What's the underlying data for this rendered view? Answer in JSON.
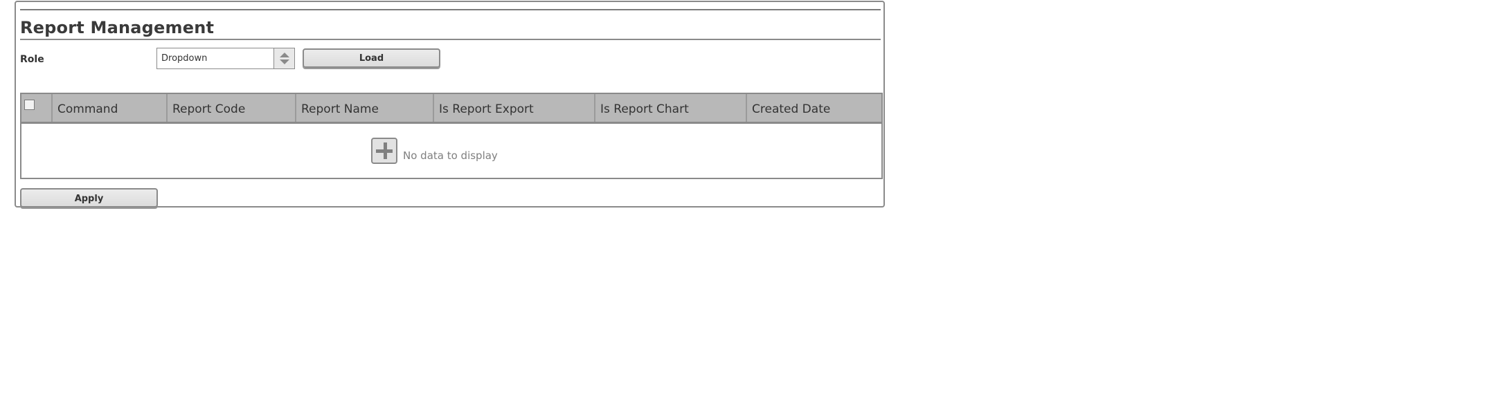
{
  "page": {
    "title": "Report Management"
  },
  "filter": {
    "role_label": "Role",
    "role_value": "Dropdown",
    "load_label": "Load"
  },
  "grid": {
    "columns": [
      "",
      "Command",
      "Report Code",
      "Report Name",
      "Is Report Export",
      "Is Report Chart",
      "Created Date"
    ],
    "rows": [],
    "empty_text": "No data to display"
  },
  "actions": {
    "apply_label": "Apply"
  },
  "icons": {
    "add": "plus-icon",
    "spinner": "up-down-arrows-icon"
  },
  "colors": {
    "header_bg": "#b8b8b8",
    "border": "#8a8a8a",
    "button_bg": "#e0e0e0"
  }
}
